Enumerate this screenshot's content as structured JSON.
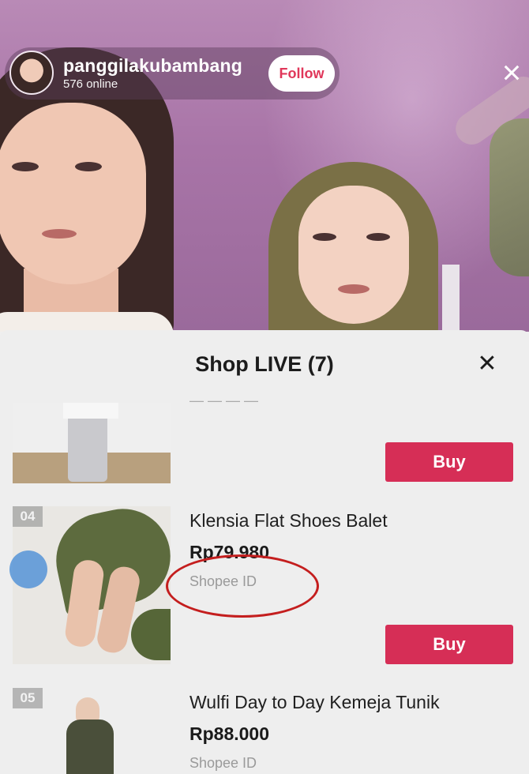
{
  "live": {
    "host_name": "panggilakubambang",
    "online_text": "576 online",
    "follow_label": "Follow",
    "close_icon": "×"
  },
  "shop_panel": {
    "title": "Shop LIVE (7)",
    "close_icon": "✕",
    "products": [
      {
        "index": "",
        "name": "",
        "price": "",
        "store": "",
        "buy_label": "Buy"
      },
      {
        "index": "04",
        "name": "Klensia Flat Shoes Balet",
        "price": "Rp79.980",
        "store": "Shopee ID",
        "buy_label": "Buy"
      },
      {
        "index": "05",
        "name": "Wulfi Day to Day Kemeja Tunik",
        "price": "Rp88.000",
        "store": "Shopee ID",
        "buy_label": "Buy"
      }
    ]
  },
  "colors": {
    "buy_button": "#d62e56",
    "annotation_circle": "#c41e1e",
    "follow_text": "#e0375a"
  }
}
